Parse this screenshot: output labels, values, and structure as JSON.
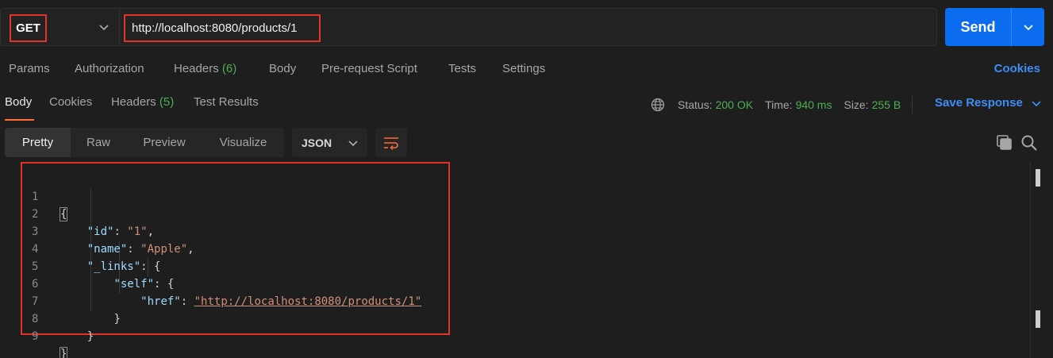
{
  "request": {
    "method": "GET",
    "url": "http://localhost:8080/products/1",
    "send_label": "Send"
  },
  "request_tabs": {
    "params": "Params",
    "authorization": "Authorization",
    "headers_label": "Headers",
    "headers_count": "(6)",
    "body": "Body",
    "pre_request": "Pre-request Script",
    "tests": "Tests",
    "settings": "Settings",
    "cookies": "Cookies"
  },
  "response_tabs": {
    "body": "Body",
    "cookies": "Cookies",
    "headers_label": "Headers",
    "headers_count": "(5)",
    "test_results": "Test Results"
  },
  "response_meta": {
    "status_label": "Status:",
    "status_value": "200 OK",
    "time_label": "Time:",
    "time_value": "940 ms",
    "size_label": "Size:",
    "size_value": "255 B",
    "save_response": "Save Response"
  },
  "view_modes": {
    "pretty": "Pretty",
    "raw": "Raw",
    "preview": "Preview",
    "visualize": "Visualize",
    "format": "JSON"
  },
  "code": {
    "line_numbers": [
      "1",
      "2",
      "3",
      "4",
      "5",
      "6",
      "7",
      "8",
      "9"
    ],
    "open_brace": "{",
    "close_brace": "}",
    "id_key": "\"id\"",
    "id_value": "\"1\"",
    "name_key": "\"name\"",
    "name_value": "\"Apple\"",
    "links_key": "\"_links\"",
    "self_key": "\"self\"",
    "href_key": "\"href\"",
    "href_value": "http://localhost:8080/products/1"
  },
  "colors": {
    "accent_orange": "#ff6c37",
    "send_blue": "#0b6cf0",
    "link_blue": "#3d8df5",
    "status_green": "#4caf50",
    "highlight_red": "#e0332b"
  }
}
